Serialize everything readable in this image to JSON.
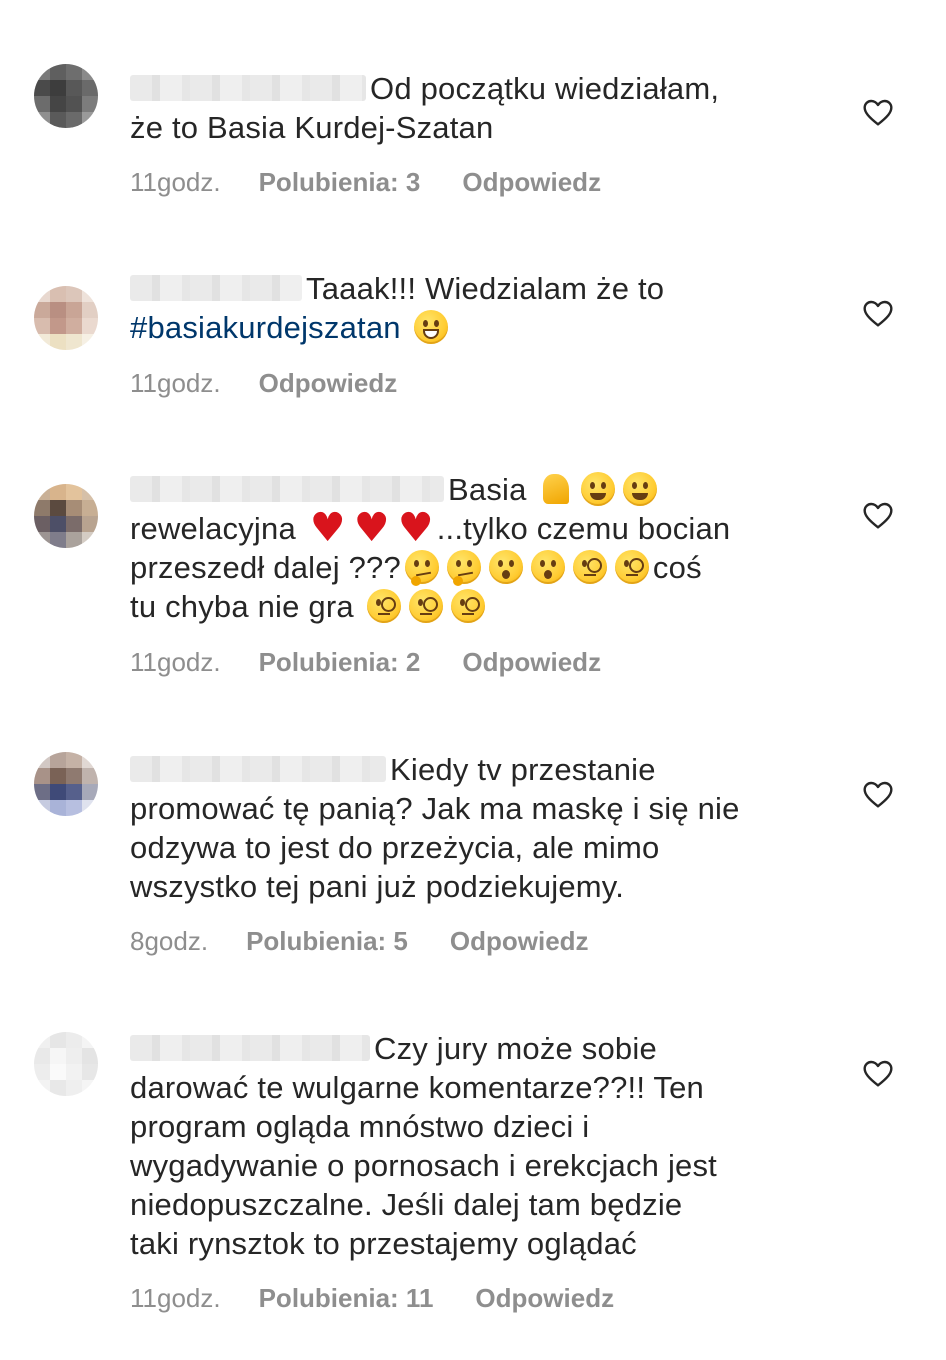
{
  "comments": [
    {
      "text_parts": [
        "Od początku wiedziałam,",
        "że to Basia Kurdej-Szatan"
      ],
      "time": "11godz.",
      "likes": "Polubienia: 3",
      "reply": "Odpowiedz"
    },
    {
      "text_parts": [
        "Taaak!!! Wiedzialam że to",
        "#basiakurdejszatan"
      ],
      "time": "11godz.",
      "reply": "Odpowiedz"
    },
    {
      "text_parts": [
        "Basia",
        "rewelacyjna",
        "...tylko czemu bocian",
        "przeszedł dalej ???",
        "coś",
        "tu chyba nie gra"
      ],
      "time": "11godz.",
      "likes": "Polubienia: 2",
      "reply": "Odpowiedz"
    },
    {
      "text_parts": [
        "Kiedy tv przestanie",
        "promować tę panią? Jak ma maskę i się nie",
        "odzywa to jest do przeżycia, ale mimo",
        "wszystko tej pani już podziekujemy."
      ],
      "time": "8godz.",
      "likes": "Polubienia: 5",
      "reply": "Odpowiedz"
    },
    {
      "text_parts": [
        "Czy jury może sobie",
        "darować te wulgarne komentarze??!! Ten",
        "program ogląda mnóstwo dzieci i",
        "wygadywanie o pornosach i erekcjach jest",
        "niedopuszczalne. Jeśli dalej tam będzie",
        "taki rynsztok to przestajemy oglądać"
      ],
      "time": "11godz.",
      "likes": "Polubienia: 11",
      "reply": "Odpowiedz"
    }
  ],
  "icons": {
    "like": "heart-outline-icon",
    "emoji_heart": "red-heart-emoji",
    "emoji_muscle": "flexed-biceps-emoji",
    "emoji_smile": "smiling-face-emoji",
    "emoji_grin": "grinning-face-emoji",
    "emoji_think": "thinking-face-emoji",
    "emoji_wow": "surprised-face-emoji",
    "emoji_monocle": "face-with-monocle-emoji"
  },
  "colors": {
    "text": "#262626",
    "meta": "#8e8e8e",
    "hashtag": "#00376b",
    "heart_emoji": "#d9141c"
  }
}
